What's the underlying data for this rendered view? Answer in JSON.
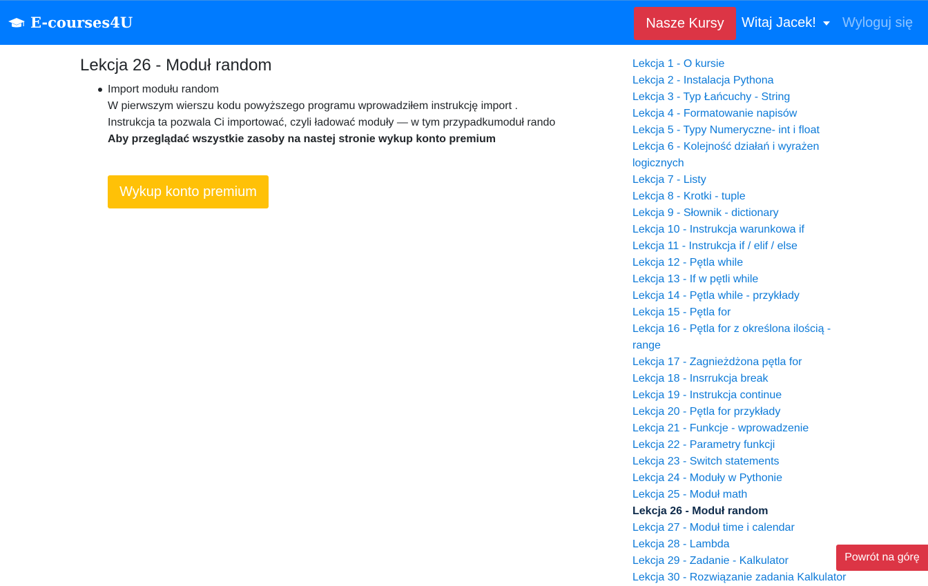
{
  "navbar": {
    "brand": "E-courses4U",
    "brand_icon": "graduation-cap-icon",
    "courses_button": "Nasze Kursy",
    "greeting": "Witaj Jacek!",
    "logout": "Wyloguj się",
    "colors": {
      "navbar_bg": "#007bff",
      "courses_button_bg": "#dc3545"
    }
  },
  "lesson": {
    "title": "Lekcja 26 - Moduł random",
    "bullet_title": "Import modułu random",
    "line1": "W pierwszym wierszu kodu powyższego programu wprowadziłem instrukcję import .",
    "line2": "Instrukcja ta pozwala Ci importować, czyli ładować moduły — w tym przypadkumoduł rando",
    "premium_note": "Aby przeglądać wszystkie zasoby na nastej stronie wykup konto premium",
    "premium_button": "Wykup konto premium",
    "premium_color": "#ffc107"
  },
  "sidebar": {
    "active_index": 25,
    "items": [
      "Lekcja 1 - O kursie",
      "Lekcja 2 - Instalacja Pythona",
      "Lekcja 3 - Typ Łańcuchy - String",
      "Lekcja 4 - Formatowanie napisów",
      "Lekcja 5 - Typy Numeryczne- int i float",
      "Lekcja 6 - Kolejność działań i wyrażen logicznych",
      "Lekcja 7 - Listy",
      "Lekcja 8 - Krotki - tuple",
      "Lekcja 9 - Słownik - dictionary",
      "Lekcja 10 - Instrukcja warunkowa if",
      "Lekcja 11 - Instrukcja if / elif / else",
      "Lekcja 12 - Pętla while",
      "Lekcja 13 - If w pętli while",
      "Lekcja 14 - Pętla while - przykłady",
      "Lekcja 15 - Pętla for",
      "Lekcja 16 - Pętla for z określona ilością - range",
      "Lekcja 17 - Zagnieżdżona pętla for",
      "Lekcja 18 - Insrrukcja break",
      "Lekcja 19 - Instrukcja continue",
      "Lekcja 20 - Pętla for przykłady",
      "Lekcja 21 - Funkcje - wprowadzenie",
      "Lekcja 22 - Parametry funkcji",
      "Lekcja 23 - Switch statements",
      "Lekcja 24 - Moduły w Pythonie",
      "Lekcja 25 - Moduł math",
      "Lekcja 26 - Moduł random",
      "Lekcja 27 - Moduł time i calendar",
      "Lekcja 28 - Lambda",
      "Lekcja 29 - Zadanie - Kalkulator",
      "Lekcja 30 - Rozwiązanie zadania Kalkulator"
    ],
    "link_color": "#0d7ad8"
  },
  "back_to_top": "Powrót na górę"
}
